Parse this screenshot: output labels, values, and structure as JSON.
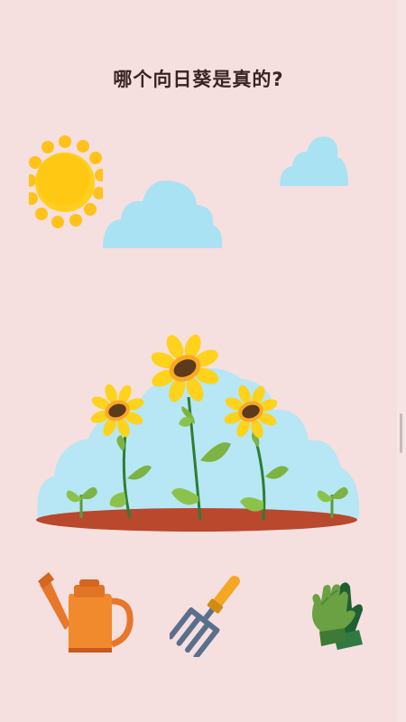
{
  "question": "哪个向日葵是真的?",
  "scene": {
    "sun": "sun-icon",
    "clouds": [
      "cloud-icon",
      "cloud-icon"
    ],
    "garden": {
      "sunflowers": 3,
      "sprouts": 2
    }
  },
  "tools": [
    {
      "name": "watering-can-icon"
    },
    {
      "name": "garden-fork-icon"
    },
    {
      "name": "gardening-gloves-icon"
    }
  ],
  "colors": {
    "background": "#f6dfdf",
    "sky_cloud": "#a9e2f3",
    "sun": "#ffc21a",
    "soil": "#b9482c",
    "petal": "#ffd21c",
    "leaf": "#8bc34a"
  }
}
